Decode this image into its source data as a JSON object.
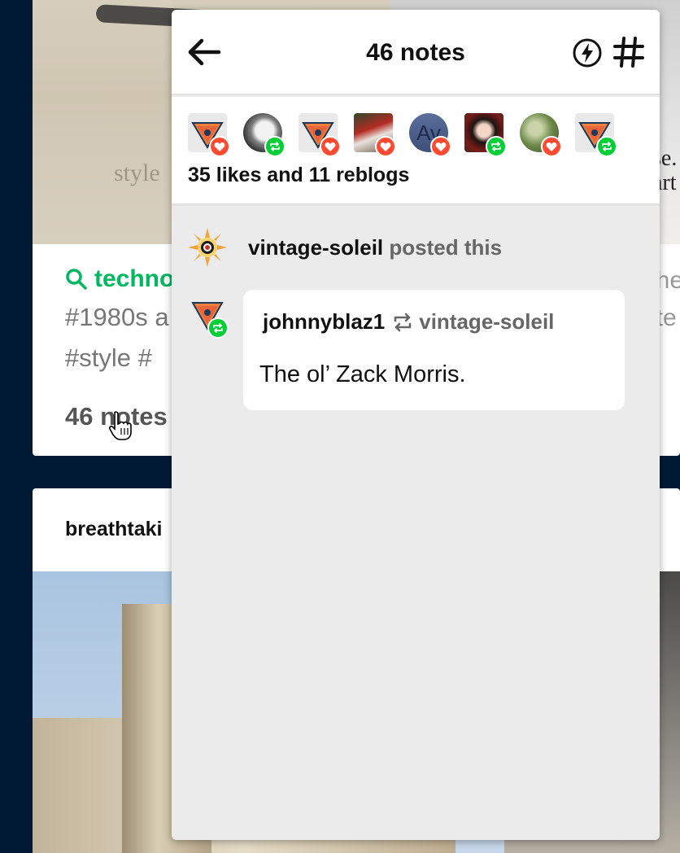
{
  "background": {
    "card1": {
      "search_label": "techno",
      "tags_line1": "#1980s a",
      "tags_line2": "#style   #",
      "right_text1": "ohe",
      "right_text2": "#te",
      "photo_text": "style",
      "photo_text_right": "se.\nart",
      "notes_count": "46 notes"
    },
    "card2": {
      "blog_name": "breathtaki"
    }
  },
  "popover": {
    "title": "46 notes",
    "summary": {
      "text": "35 likes and 11 reblogs",
      "avatars": [
        {
          "kind": "cone",
          "action": "like"
        },
        {
          "kind": "photo-bw",
          "action": "reblog"
        },
        {
          "kind": "cone",
          "action": "like"
        },
        {
          "kind": "photo-santa",
          "action": "like"
        },
        {
          "kind": "initials",
          "initials": "Av",
          "action": "like"
        },
        {
          "kind": "photo-red",
          "action": "reblog"
        },
        {
          "kind": "photo-plant",
          "action": "like"
        },
        {
          "kind": "cone",
          "action": "reblog"
        }
      ]
    },
    "original_post": {
      "blog": "vintage-soleil",
      "verb": "posted this"
    },
    "reblog": {
      "from": "johnnyblaz1",
      "to": "vintage-soleil",
      "comment": "The ol’ Zack Morris."
    }
  },
  "colors": {
    "like": "#ff4930",
    "reblog": "#00cf35",
    "tag_green": "#00b85f",
    "dashboard_bg": "#001935"
  },
  "icons": [
    "back-arrow-icon",
    "lightning-bolt-icon",
    "hashtag-icon",
    "heart-icon",
    "reblog-icon",
    "search-icon",
    "hand-cursor-icon"
  ]
}
